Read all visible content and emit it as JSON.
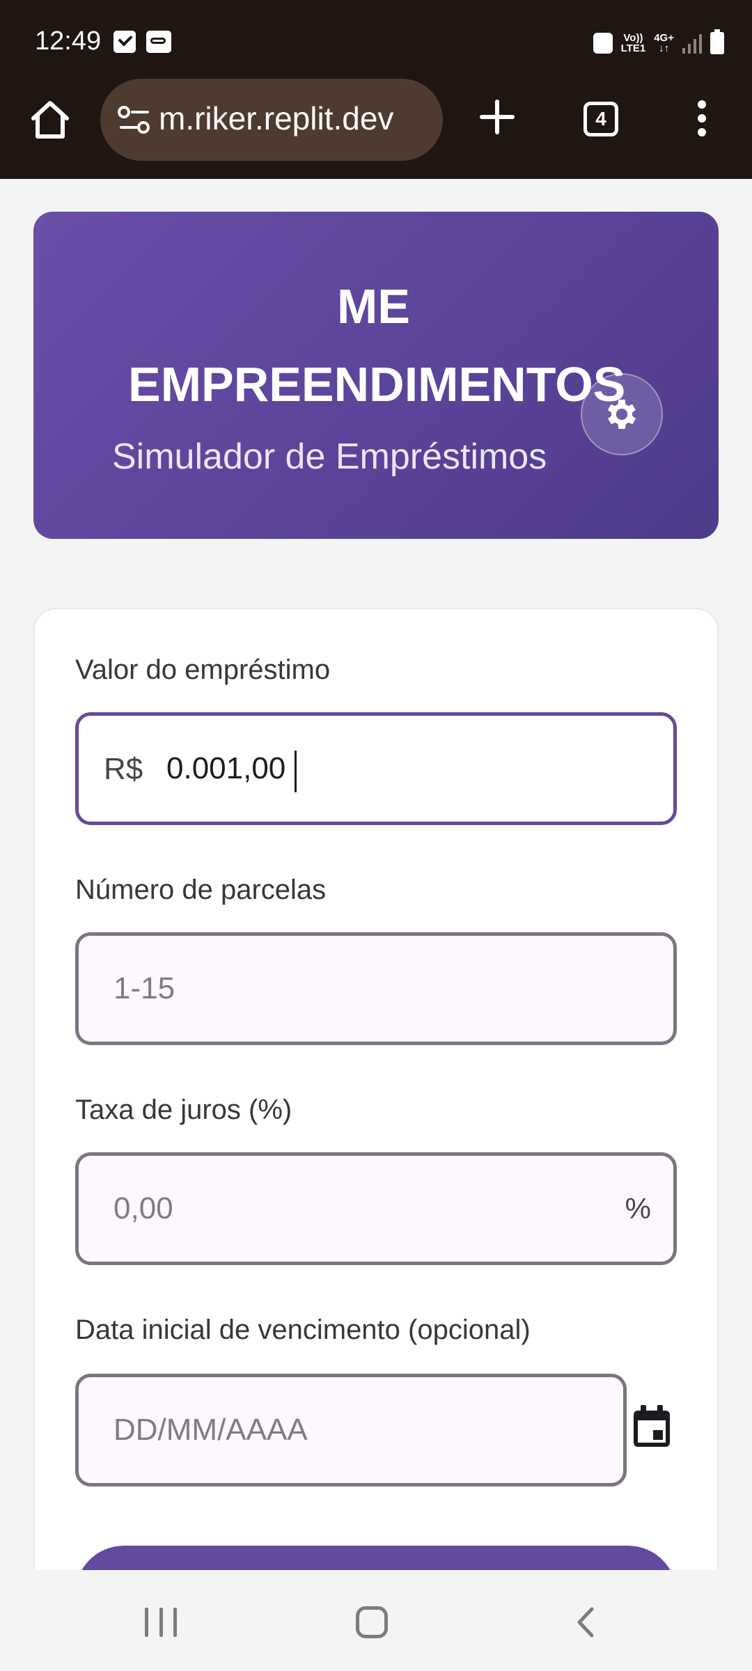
{
  "status_bar": {
    "time": "12:49",
    "net_top": "Vo))",
    "net_bottom": "LTE1",
    "net2_top": "4G+",
    "net2_bottom": "↓↑"
  },
  "browser": {
    "url": "m.riker.replit.dev",
    "tab_count": "4",
    "icons": [
      "home-icon",
      "site-settings-icon",
      "plus-icon",
      "tabs-icon",
      "more-vert-icon"
    ]
  },
  "header": {
    "brand_line1": "ME",
    "brand_line2": "EMPREENDIMENTOS",
    "subtitle": "Simulador de Empréstimos",
    "gradient_start": "#6a4ea8",
    "gradient_end": "#4e3b8c"
  },
  "form": {
    "loan": {
      "label": "Valor do empréstimo",
      "prefix": "R$",
      "value": "0.001,00"
    },
    "installments": {
      "label": "Número de parcelas",
      "placeholder": "1-15"
    },
    "interest": {
      "label": "Taxa de juros (%)",
      "placeholder": "0,00",
      "suffix": "%"
    },
    "due_date": {
      "label": "Data inicial de vencimento (opcional)",
      "placeholder": "DD/MM/AAAA"
    }
  },
  "colors": {
    "accent": "#65499e",
    "field_bg": "#fdf7fe",
    "chrome_bg": "#1f1511"
  }
}
